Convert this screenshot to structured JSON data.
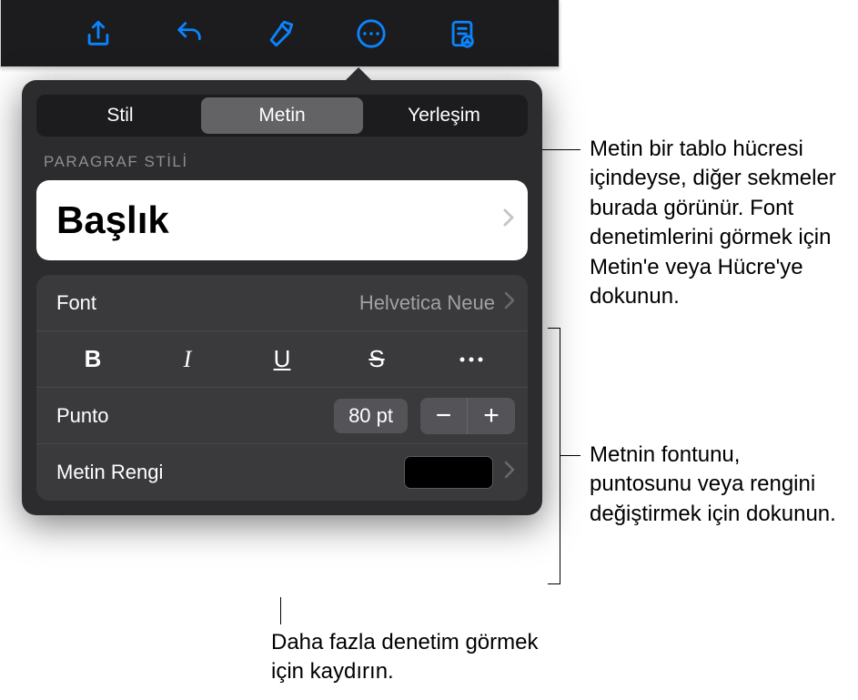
{
  "toolbar": {
    "icons": [
      "share-icon",
      "undo-icon",
      "format-icon",
      "more-icon",
      "reader-icon"
    ]
  },
  "tabs": {
    "style": "Stil",
    "text": "Metin",
    "layout": "Yerleşim"
  },
  "section_label": "PARAGRAF STİLİ",
  "paragraph_style": "Başlık",
  "font": {
    "label": "Font",
    "value": "Helvetica Neue"
  },
  "size": {
    "label": "Punto",
    "value": "80 pt"
  },
  "text_color": {
    "label": "Metin Rengi",
    "swatch": "#000000"
  },
  "callouts": {
    "tabs_note": "Metin bir tablo hücresi içindeyse, diğer sekmeler burada görünür. Font denetimlerini görmek için Metin'e veya Hücre'ye dokunun.",
    "font_note": "Metnin fontunu, puntosunu veya rengini değiştirmek için dokunun.",
    "scroll_note": "Daha fazla denetim görmek için kaydırın."
  }
}
